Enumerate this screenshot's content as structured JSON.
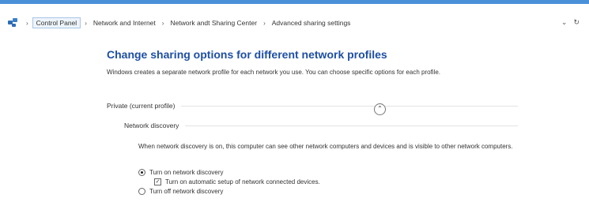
{
  "address_bar": {
    "breadcrumbs": [
      "Control Panel",
      "Network and Internet",
      "Network andt Sharing Center",
      "Advanced sharing settings"
    ],
    "separator": "›",
    "dropdown_glyph": "⌄",
    "refresh_glyph": "↻"
  },
  "main": {
    "heading": "Change sharing options for different network profiles",
    "description": "Windows creates a separate network profile for each network you use. You can  choose specific options for each profile.",
    "profile": {
      "label": "Private (current profile)",
      "collapse_glyph": "⌃"
    },
    "network_discovery": {
      "label": "Network discovery",
      "description": "When network discovery is on, this computer can see other network computers  and devices and is visible to other network computers.",
      "options": [
        {
          "label": "Turn on network discovery",
          "selected": true
        },
        {
          "label": "Turn on automatic setup of network connected devices.",
          "checked": true
        },
        {
          "label": "Turn off network discovery",
          "selected": false
        }
      ]
    }
  }
}
